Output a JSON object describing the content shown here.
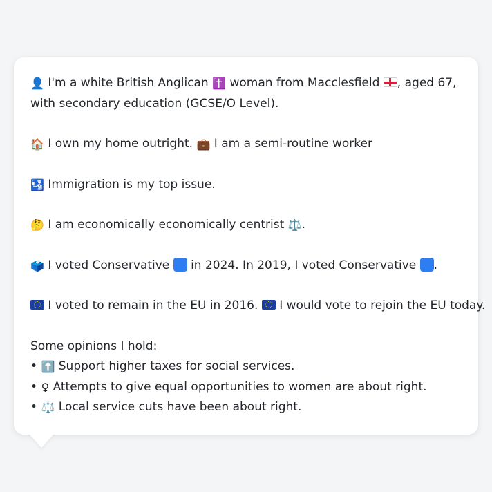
{
  "profile": {
    "line1a": "I'm a white British Anglican",
    "line1b": "woman from Macclesfield",
    "line1c": ", aged 67,",
    "line2": "with secondary education (GCSE/O Level).",
    "home": "I own my home outright.",
    "work": "I am a semi-routine worker",
    "issue": "Immigration is my top issue.",
    "econ": "I am economically economically centrist",
    "econ_end": ".",
    "vote_a": "I voted Conservative",
    "vote_b": "in 2024. In 2019, I voted Conservative",
    "vote_end": ".",
    "eu_a": "I voted to remain in the EU in 2016.",
    "eu_b": "I would vote to rejoin the EU today.",
    "opinions_heading": "Some opinions I hold:",
    "bullet_char": "•",
    "opinions": [
      "Support higher taxes for social services.",
      "Attempts to give equal opportunities to women are about right.",
      "Local service cuts have been about right."
    ]
  },
  "icons": {
    "person": "👤",
    "cross": "✝️",
    "house": "🏠",
    "briefcase": "💼",
    "passport": "🛂",
    "thinking": "🤔",
    "scales": "⚖️",
    "ballot": "🗳️",
    "up_arrow": "⬆️",
    "female": "♀"
  },
  "colors": {
    "background": "#f4f5f7",
    "card": "#ffffff",
    "text": "#23262b",
    "conservative_blue": "#2e7ef1",
    "eu_blue": "#1b3f9c"
  }
}
